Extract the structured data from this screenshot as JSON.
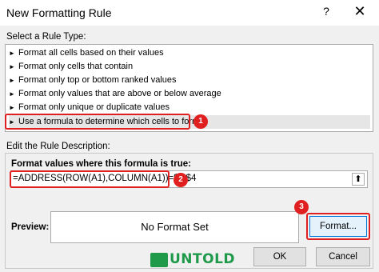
{
  "window": {
    "title": "New Formatting Rule",
    "help": "?",
    "close": "✕"
  },
  "rule_type": {
    "label": "Select a Rule Type:",
    "items": [
      "Format all cells based on their values",
      "Format only cells that contain",
      "Format only top or bottom ranked values",
      "Format only values that are above or below average",
      "Format only unique or duplicate values",
      "Use a formula to determine which cells to format"
    ],
    "selected_index": 5
  },
  "description": {
    "label": "Edit the Rule Description:",
    "formula_label": "Format values where this formula is true:",
    "formula_value": "=ADDRESS(ROW(A1),COLUMN(A1))=$G$4"
  },
  "preview": {
    "label": "Preview:",
    "text": "No Format Set"
  },
  "buttons": {
    "format": "Format...",
    "ok": "OK",
    "cancel": "Cancel"
  },
  "badges": [
    "1",
    "2",
    "3"
  ],
  "logo": {
    "text": "UNTOLD",
    "color": "#1f9a4a"
  },
  "colors": {
    "highlight": "#e02020",
    "focus": "#0078d7"
  }
}
